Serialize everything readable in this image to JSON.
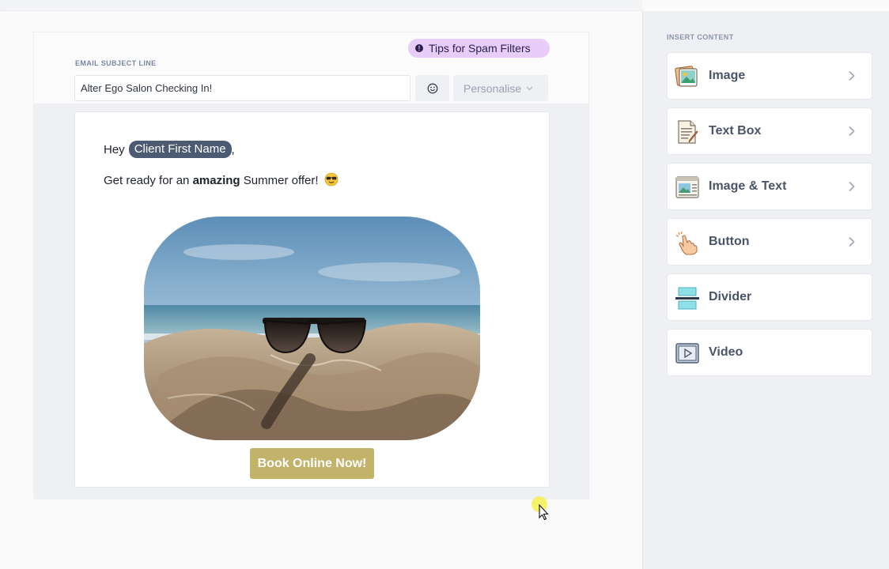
{
  "editor": {
    "subject_label": "EMAIL SUBJECT LINE",
    "spam_tips": "Tips for Spam Filters",
    "subject_value": "Alter Ego Salon Checking In!",
    "emoji_icon": "smiley-icon",
    "personalise_label": "Personalise"
  },
  "email": {
    "greeting_prefix": "Hey",
    "merge_tag": "Client First Name",
    "greeting_suffix": ",",
    "offer_before": "Get ready for an",
    "offer_bold": "amazing",
    "offer_after": "Summer offer!",
    "offer_emoji": "sunglasses-emoji",
    "image": "beach-sunglasses-photo",
    "button_label": "Book Online Now!",
    "button_color": "#c2b26a"
  },
  "sidebar": {
    "title": "INSERT CONTENT",
    "items": [
      {
        "label": "Image",
        "icon": "image-icon",
        "has_submenu": true
      },
      {
        "label": "Text Box",
        "icon": "text-box-icon",
        "has_submenu": true
      },
      {
        "label": "Image & Text",
        "icon": "image-text-icon",
        "has_submenu": true
      },
      {
        "label": "Button",
        "icon": "button-hand-icon",
        "has_submenu": true
      },
      {
        "label": "Divider",
        "icon": "divider-icon",
        "has_submenu": false
      },
      {
        "label": "Video",
        "icon": "video-icon",
        "has_submenu": false
      }
    ]
  },
  "colors": {
    "merge_tag_bg": "#4d5b72",
    "spam_tips_bg": "#e7cdf7",
    "sidebar_bg": "#eef0f3"
  }
}
